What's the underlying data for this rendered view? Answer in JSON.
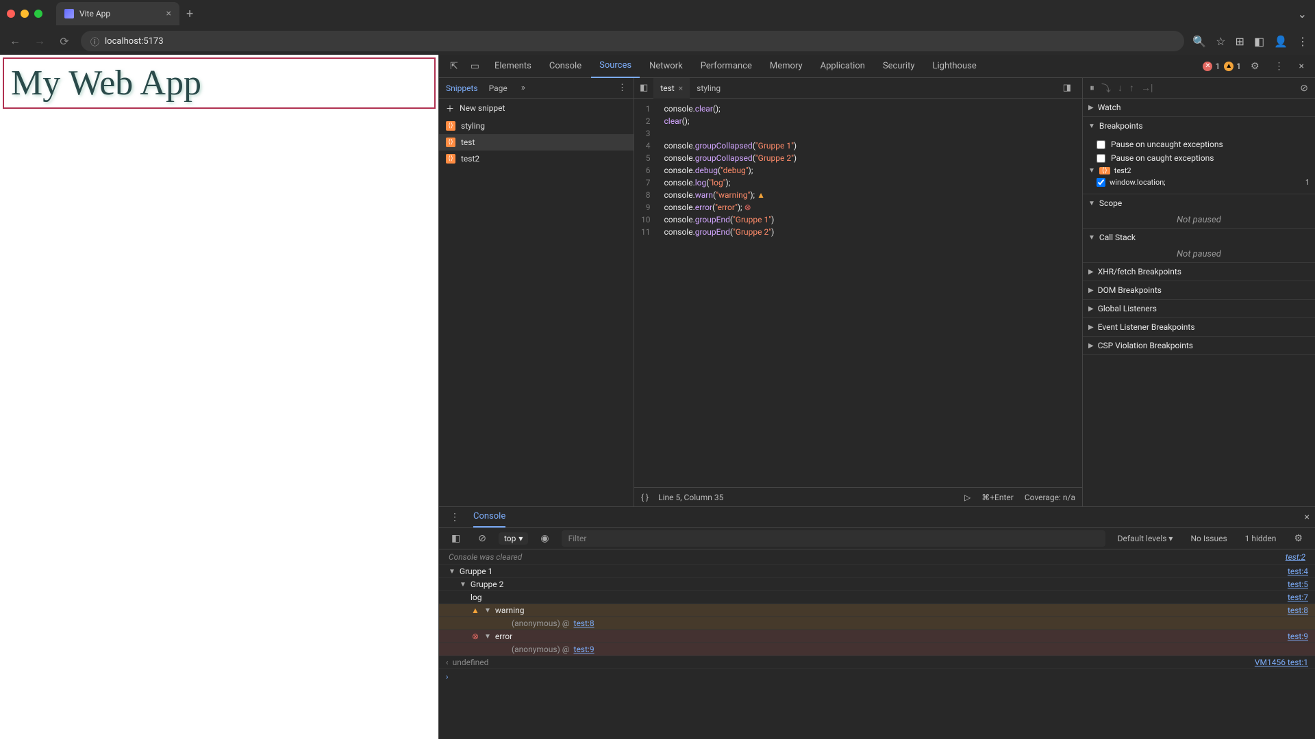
{
  "browser": {
    "tab_title": "Vite App",
    "url": "localhost:5173"
  },
  "page": {
    "heading": "My Web App"
  },
  "devtools": {
    "tabs": [
      "Elements",
      "Console",
      "Sources",
      "Network",
      "Performance",
      "Memory",
      "Application",
      "Security",
      "Lighthouse"
    ],
    "active_tab": "Sources",
    "error_count": "1",
    "warning_count": "1"
  },
  "sources": {
    "sub_tabs": [
      "Snippets",
      "Page"
    ],
    "active_sub": "Snippets",
    "new_snippet": "New snippet",
    "snippets": [
      "styling",
      "test",
      "test2"
    ],
    "active_snippet": "test",
    "editor_tabs": [
      {
        "name": "test",
        "active": true,
        "closable": true
      },
      {
        "name": "styling",
        "active": false,
        "closable": false
      }
    ],
    "code": [
      {
        "tokens": [
          "console.",
          "clear",
          "();"
        ]
      },
      {
        "tokens": [
          "clear",
          "();"
        ]
      },
      {
        "tokens": [
          ""
        ]
      },
      {
        "tokens": [
          "console.",
          "groupCollapsed",
          "(",
          "\"Gruppe 1\"",
          ")"
        ]
      },
      {
        "tokens": [
          "console.",
          "groupCollapsed",
          "(",
          "\"Gruppe 2\"",
          ")"
        ]
      },
      {
        "tokens": [
          "console.",
          "debug",
          "(",
          "\"debug\"",
          ");"
        ]
      },
      {
        "tokens": [
          "console.",
          "log",
          "(",
          "\"log\"",
          ");"
        ]
      },
      {
        "tokens": [
          "console.",
          "warn",
          "(",
          "\"warning\"",
          ");"
        ],
        "warn": true
      },
      {
        "tokens": [
          "console.",
          "error",
          "(",
          "\"error\"",
          ");"
        ],
        "err": true
      },
      {
        "tokens": [
          "console.",
          "groupEnd",
          "(",
          "\"Gruppe 1\"",
          ")"
        ]
      },
      {
        "tokens": [
          "console.",
          "groupEnd",
          "(",
          "\"Gruppe 2\"",
          ")"
        ]
      }
    ],
    "status": {
      "position": "Line 5, Column 35",
      "run_hint": "⌘+Enter",
      "coverage": "Coverage: n/a"
    }
  },
  "debug": {
    "sections": {
      "watch": "Watch",
      "breakpoints": "Breakpoints",
      "pause_uncaught": "Pause on uncaught exceptions",
      "pause_caught": "Pause on caught exceptions",
      "bp_group": "test2",
      "bp_expr": "window.location;",
      "bp_line": "1",
      "scope": "Scope",
      "not_paused": "Not paused",
      "callstack": "Call Stack",
      "xhr": "XHR/fetch Breakpoints",
      "dom": "DOM Breakpoints",
      "global": "Global Listeners",
      "event": "Event Listener Breakpoints",
      "csp": "CSP Violation Breakpoints"
    }
  },
  "console": {
    "drawer_tab": "Console",
    "context": "top",
    "filter_placeholder": "Filter",
    "levels": "Default levels",
    "no_issues": "No Issues",
    "hidden": "1 hidden",
    "cleared": "Console was cleared",
    "cleared_link": "test:2",
    "rows": [
      {
        "type": "group",
        "indent": 1,
        "text": "Gruppe 1",
        "link": "test:4"
      },
      {
        "type": "group",
        "indent": 2,
        "text": "Gruppe 2",
        "link": "test:5"
      },
      {
        "type": "log",
        "indent": 3,
        "text": "log",
        "link": "test:7"
      },
      {
        "type": "warn",
        "indent": 3,
        "text": "warning",
        "link": "test:8",
        "stack": "(anonymous) @ test:8"
      },
      {
        "type": "error",
        "indent": 3,
        "text": "error",
        "link": "test:9",
        "stack": "(anonymous) @ test:9"
      }
    ],
    "undef": "undefined",
    "undef_link": "VM1456 test:1"
  }
}
